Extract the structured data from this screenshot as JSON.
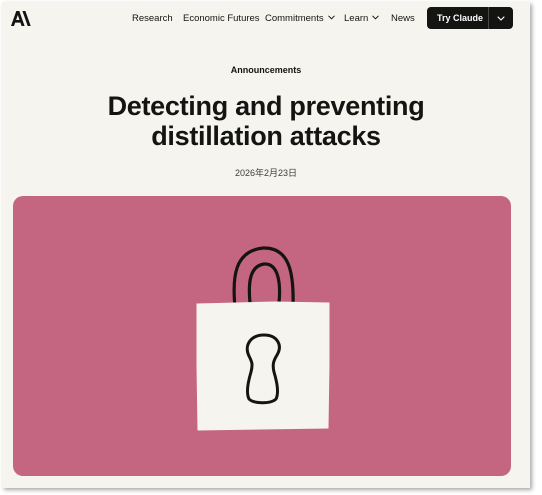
{
  "nav": {
    "logo_icon": "anthropic-logo-icon",
    "items": [
      {
        "label": "Research"
      },
      {
        "label": "Economic Futures"
      },
      {
        "label": "Commitments"
      },
      {
        "label": "Learn"
      },
      {
        "label": "News"
      }
    ],
    "cta": {
      "label": "Try Claude",
      "dropdown_icon": "chevron-down-icon"
    }
  },
  "article": {
    "category": "Announcements",
    "title": "Detecting and preventing distillation attacks",
    "date": "2026年2月23日"
  },
  "hero": {
    "illustration": "padlock-illustration",
    "background_color": "#c46682"
  },
  "colors": {
    "page_bg": "#f5f4ef",
    "text": "#141413",
    "button_bg": "#141413",
    "hero_bg": "#c46682"
  }
}
